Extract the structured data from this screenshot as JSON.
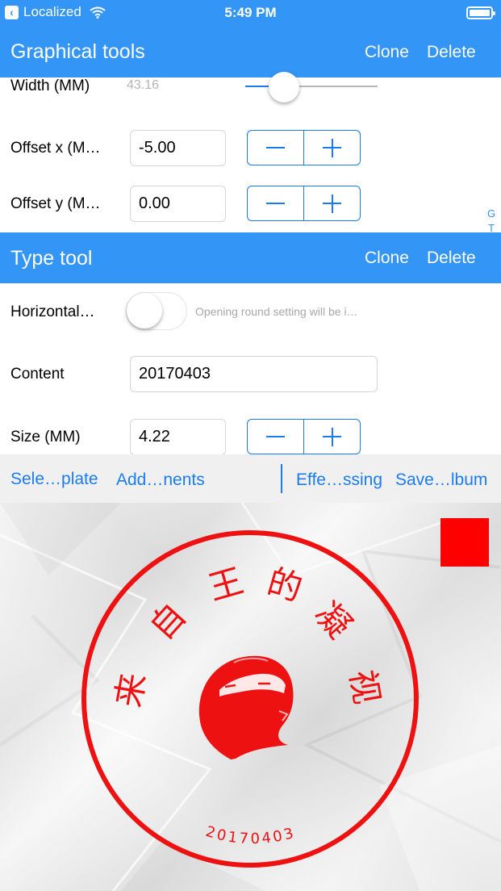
{
  "status_bar": {
    "back_label": "Localized",
    "time": "5:49 PM"
  },
  "graphical_tools": {
    "title": "Graphical tools",
    "clone": "Clone",
    "delete": "Delete",
    "width_label": "Width (MM)",
    "width_value": "43.16",
    "width_slider_fraction": 0.2,
    "offset_x_label": "Offset x (M…",
    "offset_x_value": "-5.00",
    "offset_y_label": "Offset y (M…",
    "offset_y_value": "0.00",
    "side_letters": [
      "G",
      "T"
    ]
  },
  "type_tool": {
    "title": "Type tool",
    "clone": "Clone",
    "delete": "Delete",
    "horizontal_label": "Horizontal…",
    "horizontal_on": false,
    "horizontal_hint": "Opening round setting will be i…",
    "content_label": "Content",
    "content_value": "20170403",
    "size_label": "Size (MM)",
    "size_value": "4.22"
  },
  "toolbar": {
    "select_template": "Sele…plate",
    "add_components": "Add…nents",
    "effects": "Effe…ssing",
    "save_album": "Save…lbum"
  },
  "stamp": {
    "arc_text": [
      "来",
      "自",
      "王",
      "的",
      "凝",
      "视"
    ],
    "bottom_text": "20170403",
    "color": "#ee1111"
  },
  "colors": {
    "accent": "#3395f5",
    "control_blue": "#1a7cf0",
    "stamp_red": "#ee1111",
    "swatch": "#ff0000"
  }
}
